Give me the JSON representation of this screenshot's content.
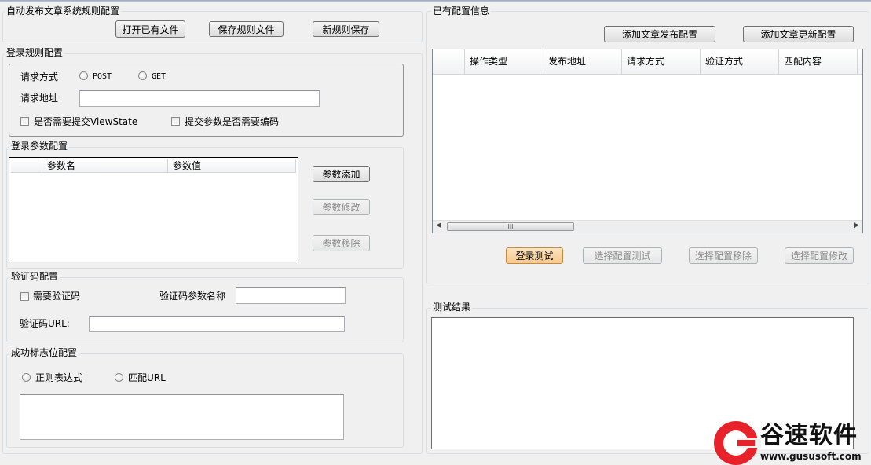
{
  "file_group": {
    "title": "自动发布文章系统规则配置",
    "open_button": "打开已有文件",
    "save_button": "保存规则文件",
    "new_button": "新规则保存"
  },
  "login_rule": {
    "title": "登录规则配置",
    "method_label": "请求方式",
    "method_post": "POST",
    "method_get": "GET",
    "url_label": "请求地址",
    "url_value": "",
    "viewstate_label": "是否需要提交ViewState",
    "encode_label": "提交参数是否需要编码"
  },
  "login_params": {
    "title": "登录参数配置",
    "columns": [
      "参数名",
      "参数值"
    ],
    "rows": [],
    "add_button": "参数添加",
    "edit_button": "参数修改",
    "remove_button": "参数移除"
  },
  "captcha": {
    "title": "验证码配置",
    "need_label": "需要验证码",
    "param_name_label": "验证码参数名称",
    "param_name_value": "",
    "url_label": "验证码URL:",
    "url_value": ""
  },
  "success_flag": {
    "title": "成功标志位配置",
    "regex_label": "正则表达式",
    "match_url_label": "匹配URL",
    "value": ""
  },
  "existing_config": {
    "title": "已有配置信息",
    "add_publish_button": "添加文章发布配置",
    "add_update_button": "添加文章更新配置",
    "columns": [
      "操作类型",
      "发布地址",
      "请求方式",
      "验证方式",
      "匹配内容"
    ],
    "rows": [],
    "scroll_thumb_glyph": "III",
    "login_test_button": "登录测试",
    "test_selected_button": "选择配置测试",
    "remove_selected_button": "选择配置移除",
    "edit_selected_button": "选择配置修改"
  },
  "test_result": {
    "title": "测试结果",
    "value": ""
  },
  "watermark": {
    "brand": "谷速软件",
    "url": "www.gususoft.com",
    "color": "#e8222a"
  }
}
